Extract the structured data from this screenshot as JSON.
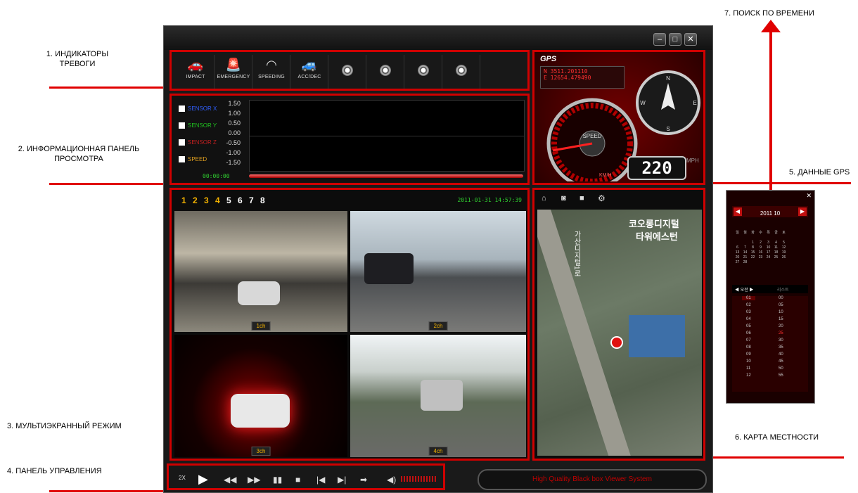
{
  "annotations": {
    "a1_line1": "1. ИНДИКАТОРЫ",
    "a1_line2": "ТРЕВОГИ",
    "a2_line1": "2. ИНФОРМАЦИОННАЯ ПАНЕЛЬ",
    "a2_line2": "ПРОСМОТРА",
    "a3": "3. МУЛЬТИЭКРАННЫЙ РЕЖИМ",
    "a4": "4. ПАНЕЛЬ УПРАВЛЕНИЯ",
    "a5": "5. ДАННЫЕ GPS",
    "a6": "6. КАРТА МЕСТНОСТИ",
    "a7": "7. ПОИСК ПО ВРЕМЕНИ"
  },
  "window": {
    "minimize": "–",
    "maximize": "□",
    "close": "✕"
  },
  "alarms": [
    {
      "label": "IMPACT",
      "icon": "impact-car-icon"
    },
    {
      "label": "EMERGENCY",
      "icon": "siren-icon"
    },
    {
      "label": "SPEEDING",
      "icon": "speedometer-icon"
    },
    {
      "label": "ACC/DEC",
      "icon": "accel-car-icon"
    }
  ],
  "sensors": [
    {
      "label": "SENSOR X",
      "color": "#3060ff"
    },
    {
      "label": "SENSOR Y",
      "color": "#20c020"
    },
    {
      "label": "SENSOR Z",
      "color": "#c02020"
    },
    {
      "label": "SPEED",
      "color": "#e0a020"
    }
  ],
  "yticks": [
    "1.50",
    "1.00",
    "0.50",
    "0.00",
    "-0.50",
    "-1.00",
    "-1.50"
  ],
  "timeline_time": "00:00:00",
  "gps": {
    "title": "GPS",
    "lat": "N   3511.201110",
    "lon": "E   12654.479490",
    "speed_label": "SPEED",
    "speed_value": "220",
    "unit_mph": "MPH",
    "unit_kmh": "KM/H",
    "compass": [
      "N",
      "E",
      "S",
      "W"
    ]
  },
  "channels": {
    "numbers": [
      "1",
      "2",
      "3",
      "4",
      "5",
      "6",
      "7",
      "8"
    ],
    "datetime": "2011-01-31  14:57:39",
    "labels": [
      "1ch",
      "2ch",
      "3ch",
      "4ch"
    ]
  },
  "map": {
    "label1": "코오롱디지털",
    "label2": "타워에스턴",
    "road": "가산디지털1로"
  },
  "controls": {
    "speed": "2X"
  },
  "status_text": "High Quality Black box Viewer System",
  "calendar": {
    "year_month": "2011  10",
    "weekdays": [
      "일",
      "월",
      "화",
      "수",
      "목",
      "금",
      "토"
    ],
    "week1": [
      "",
      "",
      "1",
      "2",
      "3",
      "4",
      "5"
    ],
    "week2": [
      "6",
      "7",
      "8",
      "9",
      "10",
      "11",
      "12"
    ],
    "week3": [
      "13",
      "14",
      "15",
      "16",
      "17",
      "18",
      "19"
    ],
    "week4": [
      "20",
      "21",
      "22",
      "23",
      "24",
      "25",
      "26"
    ],
    "week5": [
      "27",
      "28",
      "",
      "",
      "",
      "",
      ""
    ],
    "tab_left": "오전",
    "tab_right": "리스트",
    "hours": [
      "01",
      "02",
      "03",
      "04",
      "05",
      "06",
      "07",
      "08",
      "09",
      "10",
      "11",
      "12"
    ],
    "minutes": [
      "00",
      "05",
      "10",
      "15",
      "20",
      "25",
      "30",
      "35",
      "40",
      "45",
      "50",
      "55"
    ]
  },
  "colors": {
    "accent": "#d00000",
    "panel_bg": "#111111",
    "highlight": "#f0b000"
  }
}
